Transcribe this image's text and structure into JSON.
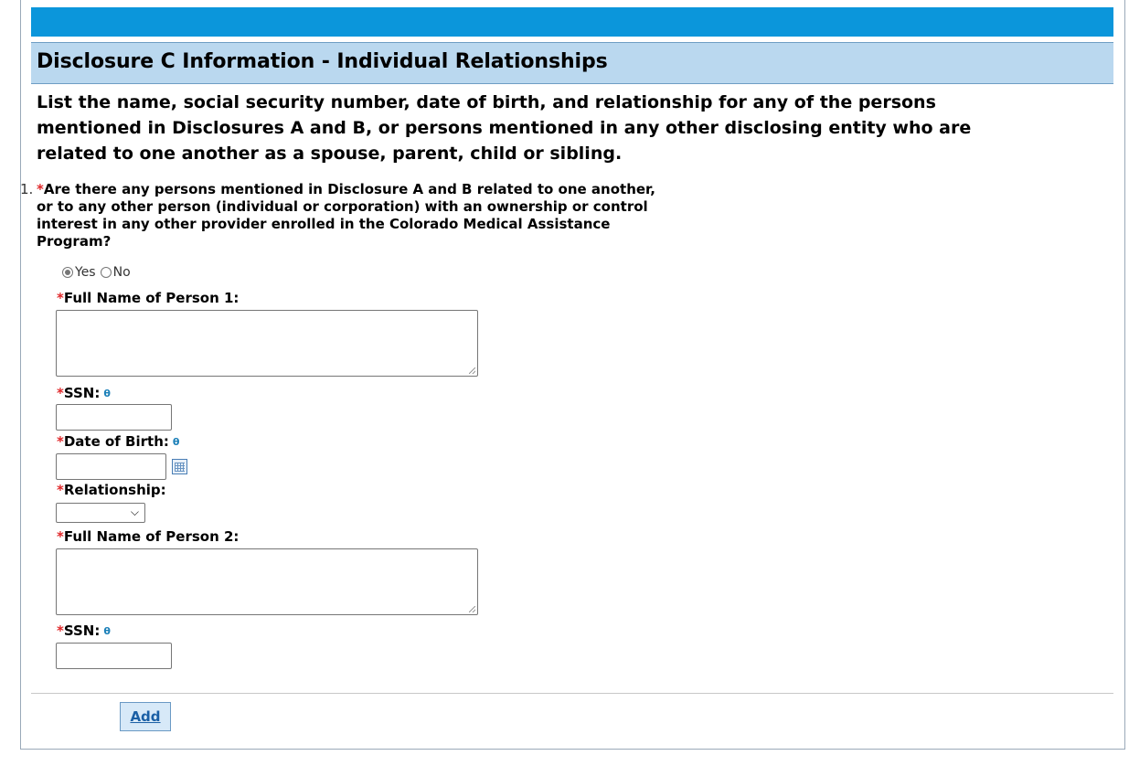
{
  "header": {
    "title": "Disclosure C Information - Individual Relationships"
  },
  "instructions": {
    "lines": [
      "List the name, social security number, date of birth, and relationship for any of the persons",
      "mentioned in Disclosures A and B, or persons mentioned in any other disclosing entity who are",
      "related to one another as a spouse, parent, child or sibling."
    ]
  },
  "question": {
    "number": "1.",
    "required_mark": "*",
    "lines": [
      "Are there any persons mentioned in Disclosure A and B related to one another,",
      "or to any other person (individual or corporation) with an ownership or control",
      "interest in any other provider enrolled in the Colorado Medical Assistance",
      "Program?"
    ],
    "options": [
      {
        "label": "Yes",
        "selected": true
      },
      {
        "label": "No",
        "selected": false
      }
    ]
  },
  "fields": {
    "required_mark": "*",
    "person1_name_label": "Full Name of Person 1:",
    "ssn1_label": "SSN:",
    "dob_label": "Date of Birth:",
    "relationship_label": "Relationship:",
    "relationship_value": "",
    "person2_name_label": "Full Name of Person 2:",
    "ssn2_label": "SSN:",
    "info_icon_glyph": "θ"
  },
  "actions": {
    "add_label": "Add"
  },
  "colors": {
    "topbar": "#0b96db",
    "section_header_bg": "#bad8ef",
    "required": "#e0282a",
    "info_icon": "#1a7fb8",
    "button_bg": "#d7e9f8"
  }
}
